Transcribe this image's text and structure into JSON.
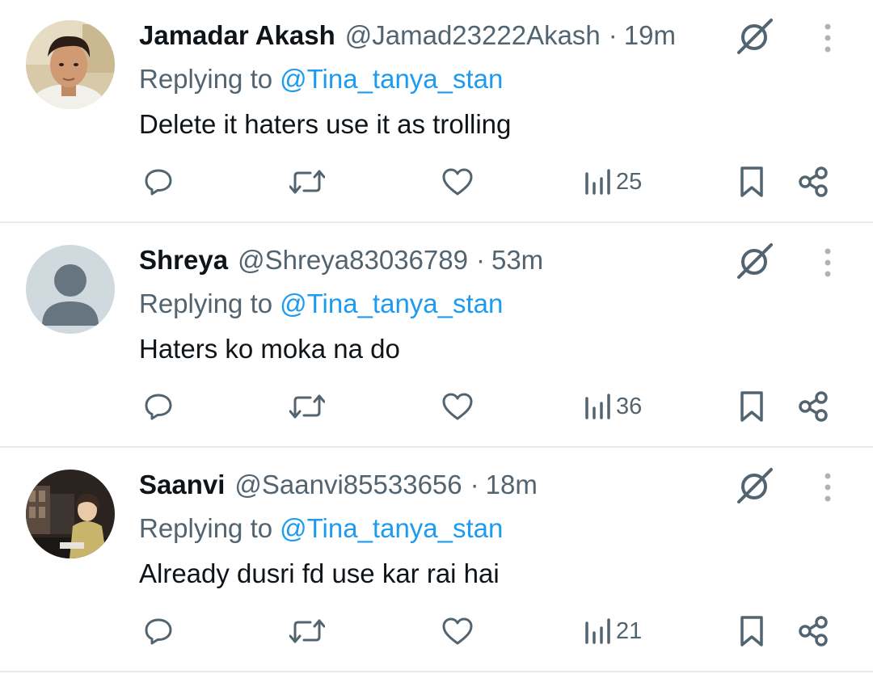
{
  "colors": {
    "text_primary": "#0f1419",
    "text_secondary": "#536471",
    "link": "#1d9bf0",
    "divider": "#e9ecee",
    "icon": "#536471"
  },
  "icons": {
    "reply": "speech-bubble-icon",
    "retweet": "retweet-arrows-icon",
    "like": "heart-icon",
    "views": "bar-chart-icon",
    "bookmark": "bookmark-icon",
    "share": "share-nodes-icon",
    "grok": "grok-slash-circle-icon",
    "more": "vertical-dots-icon"
  },
  "tweets": [
    {
      "display_name": "Jamadar Akash",
      "handle": "@Jamad23222Akash",
      "separator": "·",
      "time": "19m",
      "reply_prefix": "Replying to",
      "reply_to": "@Tina_tanya_stan",
      "text": "Delete it haters use it as trolling",
      "views": "25",
      "avatar": "photo"
    },
    {
      "display_name": "Shreya",
      "handle": "@Shreya83036789",
      "separator": "·",
      "time": "53m",
      "reply_prefix": "Replying to",
      "reply_to": "@Tina_tanya_stan",
      "text": "Haters ko moka na do",
      "views": "36",
      "avatar": "default"
    },
    {
      "display_name": "Saanvi",
      "handle": "@Saanvi85533656",
      "separator": "·",
      "time": "18m",
      "reply_prefix": "Replying to",
      "reply_to": "@Tina_tanya_stan",
      "text": "Already dusri fd use kar rai hai",
      "views": "21",
      "avatar": "photo"
    }
  ]
}
